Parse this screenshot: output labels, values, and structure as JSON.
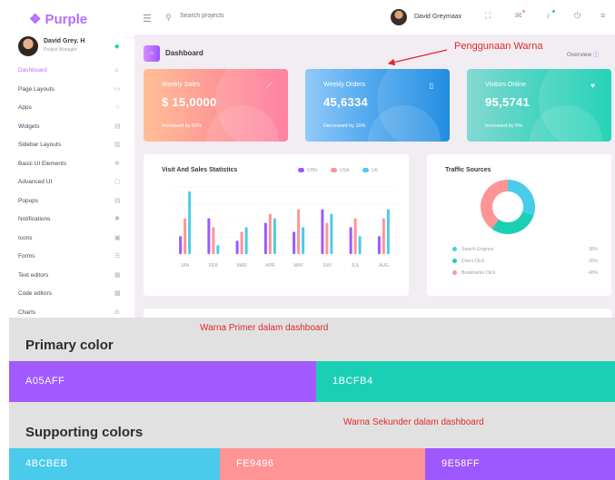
{
  "colors": {
    "primary_purple": "#A05AFF",
    "primary_teal": "#1BCFB4",
    "support_blue": "#4BCBEB",
    "support_pink": "#FE9496",
    "support_violet": "#9E58FF",
    "annotation_red": "#E0292C"
  },
  "navbar": {
    "brand": "Purple",
    "brand_icon": "gem-icon",
    "search_placeholder": "Search projects",
    "user_name": "David Greymaax",
    "icons": [
      "menu-icon",
      "search-icon",
      "fullscreen-icon",
      "mail-icon",
      "bell-icon",
      "power-icon",
      "grid-icon"
    ]
  },
  "sidebar": {
    "profile": {
      "name": "David Grey. H",
      "role": "Project Manager"
    },
    "items": [
      {
        "label": "Dashboard",
        "icon": "home-icon"
      },
      {
        "label": "Page Layouts",
        "icon": "layout-icon"
      },
      {
        "label": "Apps",
        "icon": "apps-icon"
      },
      {
        "label": "Widgets",
        "icon": "widgets-icon"
      },
      {
        "label": "Sidebar Layouts",
        "icon": "sidebar-icon"
      },
      {
        "label": "Basic UI Elements",
        "icon": "crosshair-icon"
      },
      {
        "label": "Advanced UI",
        "icon": "monitor-icon"
      },
      {
        "label": "Popups",
        "icon": "popup-icon"
      },
      {
        "label": "Notifications",
        "icon": "bell-icon"
      },
      {
        "label": "Icons",
        "icon": "contacts-icon"
      },
      {
        "label": "Forms",
        "icon": "form-icon"
      },
      {
        "label": "Text editors",
        "icon": "text-icon"
      },
      {
        "label": "Code editors",
        "icon": "code-icon"
      },
      {
        "label": "Charts",
        "icon": "chart-icon"
      }
    ]
  },
  "page": {
    "title": "Dashboard",
    "overview": "Overview"
  },
  "stats": [
    {
      "label": "Weekly Sales",
      "value": "$ 15,0000",
      "sub": "Increased by 60%"
    },
    {
      "label": "Weekly Orders",
      "value": "45,6334",
      "sub": "Decreased by 10%"
    },
    {
      "label": "Visitors Online",
      "value": "95,5741",
      "sub": "Increased by 5%"
    }
  ],
  "chart_data": [
    {
      "type": "bar",
      "title": "Visit And Sales Statistics",
      "categories": [
        "JAN",
        "FEB",
        "MAR",
        "APR",
        "MAY",
        "JUN",
        "JUL",
        "AUG"
      ],
      "series": [
        {
          "name": "CHN",
          "color": "#9E58FF",
          "values": [
            20,
            40,
            15,
            35,
            25,
            50,
            30,
            20
          ]
        },
        {
          "name": "USA",
          "color": "#FE9496",
          "values": [
            40,
            30,
            25,
            45,
            50,
            35,
            40,
            40
          ]
        },
        {
          "name": "UK",
          "color": "#4BCBEB",
          "values": [
            70,
            10,
            30,
            40,
            30,
            45,
            20,
            50
          ]
        }
      ],
      "ylim": [
        0,
        75
      ],
      "legend": "top-right",
      "grid": true
    },
    {
      "type": "pie",
      "title": "Traffic Sources",
      "categories": [
        "Search Engines",
        "Direct Click",
        "Bookmarks Click"
      ],
      "values": [
        30,
        30,
        40
      ],
      "value_labels": [
        "30%",
        "30%",
        "40%"
      ],
      "colors": [
        "#4BCBEB",
        "#1BCFB4",
        "#FE9496"
      ]
    }
  ],
  "annotations": {
    "usage": "Penggunaan Warna",
    "primary": "Warna Primer dalam dashboard",
    "secondary": "Warna Sekunder dalam dashboard"
  },
  "palette": {
    "primary_title": "Primary color",
    "supporting_title": "Supporting colors",
    "primary": [
      {
        "hex": "A05AFF",
        "color": "#A05AFF"
      },
      {
        "hex": "1BCFB4",
        "color": "#1BCFB4"
      }
    ],
    "supporting": [
      {
        "hex": "4BCBEB",
        "color": "#4BCBEB"
      },
      {
        "hex": "FE9496",
        "color": "#FE9496"
      },
      {
        "hex": "9E58FF",
        "color": "#9E58FF"
      }
    ]
  }
}
